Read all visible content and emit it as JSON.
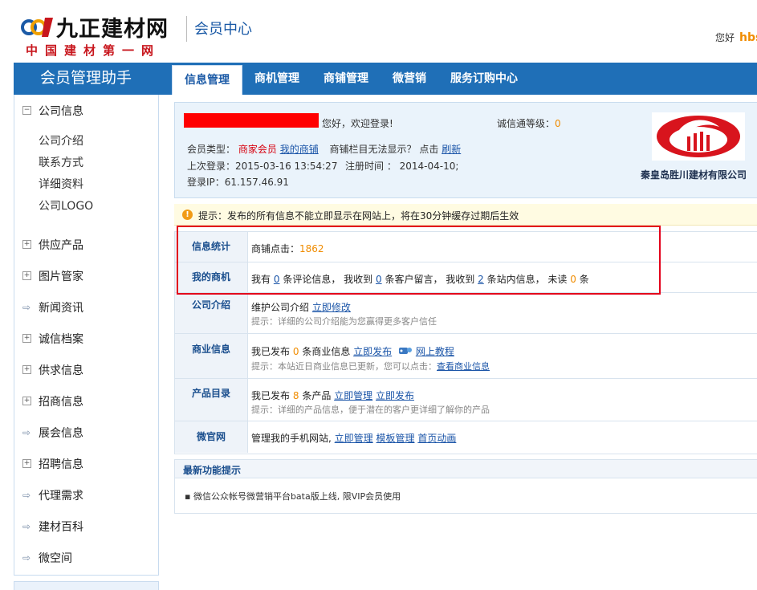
{
  "header": {
    "logo_title": "九正建材网",
    "logo_subtitle": "中国建材第一网",
    "section_title": "会员中心",
    "greeting": "您好",
    "username": "hbs"
  },
  "nav": {
    "brand": "会员管理助手",
    "tabs": [
      {
        "label": "信息管理",
        "active": true
      },
      {
        "label": "商机管理",
        "active": false
      },
      {
        "label": "商铺管理",
        "active": false
      },
      {
        "label": "微营销",
        "active": false
      },
      {
        "label": "服务订购中心",
        "active": false
      }
    ]
  },
  "sidebar": {
    "groups": [
      {
        "label": "公司信息",
        "icon": "minus-box-icon",
        "sub": [
          "公司介绍",
          "联系方式",
          "详细资料",
          "公司LOGO"
        ]
      },
      {
        "label": "供应产品",
        "icon": "plus-box-icon"
      },
      {
        "label": "图片管家",
        "icon": "plus-box-icon"
      },
      {
        "label": "新闻资讯",
        "icon": "arrow-right-icon"
      },
      {
        "label": "诚信档案",
        "icon": "plus-box-icon"
      },
      {
        "label": "供求信息",
        "icon": "plus-box-icon"
      },
      {
        "label": "招商信息",
        "icon": "plus-box-icon"
      },
      {
        "label": "展会信息",
        "icon": "arrow-right-icon"
      },
      {
        "label": "招聘信息",
        "icon": "plus-box-icon"
      },
      {
        "label": "代理需求",
        "icon": "arrow-right-icon"
      },
      {
        "label": "建材百科",
        "icon": "arrow-right-icon"
      },
      {
        "label": "微空间",
        "icon": "arrow-right-icon"
      }
    ]
  },
  "profile": {
    "welcome": "您好，欢迎登录!",
    "credit_label": "诚信通等级：",
    "credit_value": "0",
    "member_type_label": "会员类型：",
    "member_type_value": "商家会员",
    "my_shop_link": "我的商铺",
    "shop_hint": "商铺栏目无法显示？ 点击",
    "refresh_link": "刷新",
    "last_login": "上次登录：2015-03-16 13:54:27",
    "register_time": "注册时间 ： 2014-04-10;",
    "login_ip": "登录IP：61.157.46.91",
    "company_name": "秦皇岛胜川建材有限公司"
  },
  "notice": {
    "text": "提示：发布的所有信息不能立即显示在网站上，将在30分钟缓存过期后生效"
  },
  "info": {
    "stats": {
      "head": "信息统计",
      "label": "商铺点击：",
      "value": "1862"
    },
    "opps": {
      "head": "我的商机",
      "t1": "我有",
      "v1": "0",
      "t2": "条评论信息，  我收到",
      "v2": "0",
      "t3": "条客户留言，  我收到",
      "v3": "2",
      "t4": "条站内信息，  未读",
      "v4": "0",
      "t5": "条"
    },
    "company": {
      "head": "公司介绍",
      "main": "维护公司介绍",
      "link": "立即修改",
      "hint": "提示：详细的公司介绍能为您赢得更多客户信任"
    },
    "business": {
      "head": "商业信息",
      "t1": "我已发布",
      "v1": "0",
      "t2": "条商业信息",
      "link1": "立即发布",
      "link2": "网上教程",
      "hint": "提示：本站近日商业信息已更新，您可以点击：",
      "hint_link": "查看商业信息"
    },
    "products": {
      "head": "产品目录",
      "t1": "我已发布",
      "v1": "8",
      "t2": "条产品",
      "link1": "立即管理",
      "link2": "立即发布",
      "hint": "提示：详细的产品信息，便于潜在的客户更详细了解你的产品"
    },
    "micro": {
      "head": "微官网",
      "main": "管理我的手机网站,",
      "link1": "立即管理",
      "link2": "模板管理",
      "link3": "首页动画"
    }
  },
  "latest": {
    "title": "最新功能提示",
    "item": "微信公众帐号微营销平台bata版上线, 限VIP会员使用"
  }
}
